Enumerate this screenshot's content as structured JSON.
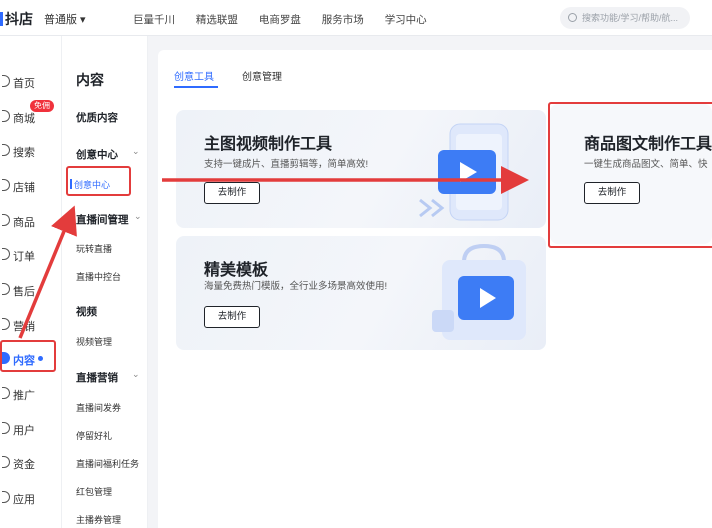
{
  "topbar": {
    "logo": "抖店",
    "edition": "普通版 ▾",
    "nav": [
      "巨量千川",
      "精选联盟",
      "电商罗盘",
      "服务市场",
      "学习中心"
    ],
    "search_placeholder": "搜索功能/学习/帮助/航..."
  },
  "leftnav": {
    "items": [
      {
        "label": "首页"
      },
      {
        "label": "商城",
        "badge": "免佣"
      },
      {
        "label": "搜索"
      },
      {
        "label": "店铺"
      },
      {
        "label": "商品"
      },
      {
        "label": "订单"
      },
      {
        "label": "售后"
      },
      {
        "label": "营销"
      },
      {
        "label": "内容"
      },
      {
        "label": "推广"
      },
      {
        "label": "用户"
      },
      {
        "label": "资金"
      },
      {
        "label": "应用"
      }
    ]
  },
  "subnav": {
    "title": "内容",
    "groups": [
      {
        "label": "优质内容",
        "items": []
      },
      {
        "label": "创意中心",
        "items": [
          "创意中心"
        ]
      },
      {
        "label": "直播间管理",
        "items": [
          "玩转直播",
          "直播中控台"
        ]
      },
      {
        "label": "视频",
        "items": [
          "视频管理"
        ]
      },
      {
        "label": "直播营销",
        "items": [
          "直播间发券",
          "停留好礼",
          "直播间福利任务",
          "红包管理",
          "主播券管理"
        ]
      }
    ]
  },
  "tabs": [
    "创意工具",
    "创意管理"
  ],
  "cards": [
    {
      "title": "主图视频制作工具",
      "desc": "支持一键成片、直播剪辑等，简单高效!",
      "button": "去制作"
    },
    {
      "title": "商品图文制作工具",
      "desc": "一键生成商品图文、简单、快",
      "button": "去制作"
    },
    {
      "title": "精美模板",
      "desc": "海量免费热门模版，全行业多场景高效使用!",
      "button": "去制作"
    }
  ],
  "colors": {
    "accent": "#2f6bff",
    "annotation": "#e33c3c",
    "badge": "#f0323c"
  },
  "icons": [
    "search-icon",
    "play-icon",
    "chevron-down-icon"
  ]
}
